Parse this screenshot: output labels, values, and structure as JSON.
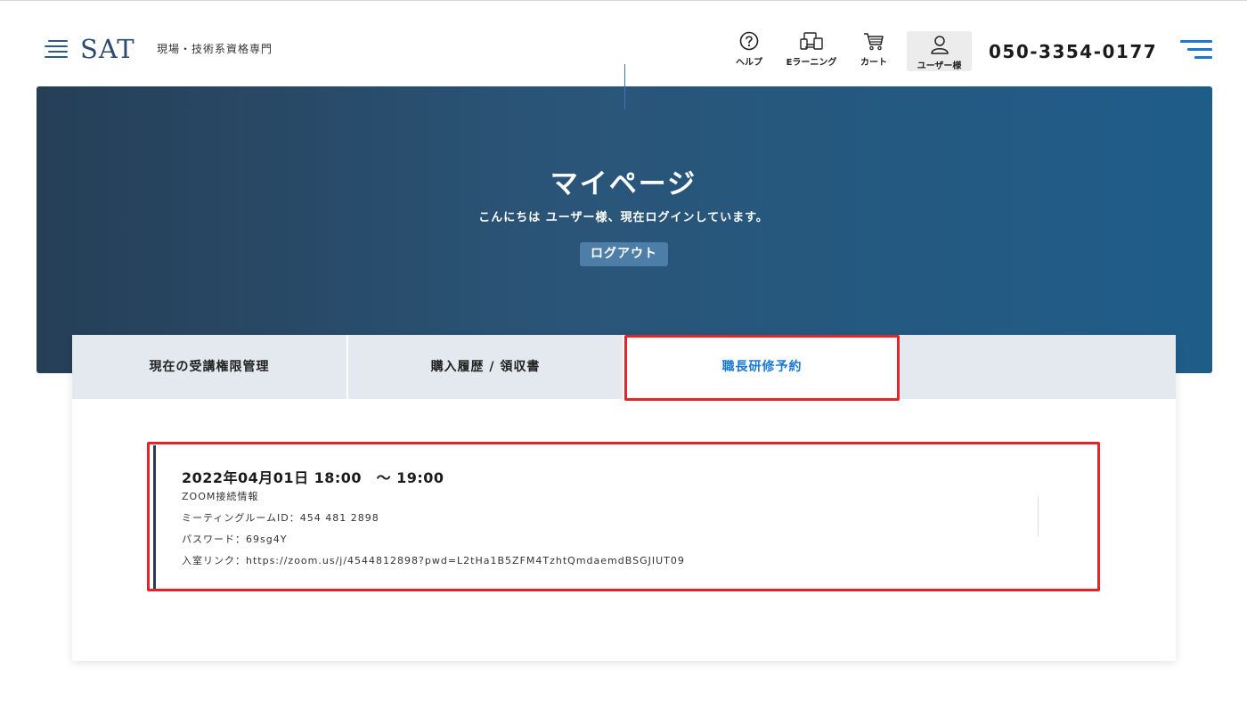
{
  "header": {
    "logo_text": "SAT",
    "logo_subtitle": "現場・技術系資格専門",
    "nav": [
      {
        "icon": "help-icon",
        "label": "ヘルプ"
      },
      {
        "icon": "elearning-icon",
        "label": "Eラーニング"
      },
      {
        "icon": "cart-icon",
        "label": "カート"
      },
      {
        "icon": "user-icon",
        "label": "ユーザー様"
      }
    ],
    "phone": "050-3354-0177",
    "menu_icon": "hamburger-menu-icon"
  },
  "hero": {
    "title": "マイページ",
    "greeting": "こんにちは ユーザー様、現在ログインしています。",
    "logout_label": "ログアウト"
  },
  "tabs": [
    {
      "label": "現在の受講権限管理",
      "active": false
    },
    {
      "label": "購入履歴 / 領収書",
      "active": false
    },
    {
      "label": "職長研修予約",
      "active": true
    }
  ],
  "reservation": {
    "datetime": "2022年04月01日 18:00　～ 19:00",
    "zoom_heading": "ZOOM接続情報",
    "meeting_id": "ミーティングルームID：454 481 2898",
    "password": "パスワード：69sg4Y",
    "link": "入室リンク：https://zoom.us/j/4544812898?pwd=L2tHa1B5ZFM4TzhtQmdaemdBSGJIUT09"
  },
  "colors": {
    "accent": "#1a78d2",
    "highlight": "#e2242b",
    "hero_start": "#263f57",
    "hero_end": "#1f5d89",
    "tab_bg": "#e4e9ef"
  }
}
